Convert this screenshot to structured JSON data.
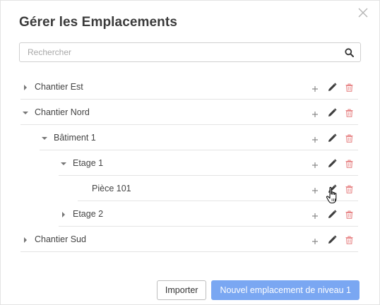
{
  "dialog": {
    "title": "Gérer les Emplacements"
  },
  "search": {
    "placeholder": "Rechercher",
    "value": ""
  },
  "tree": {
    "rows": [
      {
        "label": "Chantier Est",
        "toggle": "collapsed"
      },
      {
        "label": "Chantier Nord",
        "toggle": "expanded"
      },
      {
        "label": "Bâtiment 1",
        "toggle": "expanded"
      },
      {
        "label": "Etage 1",
        "toggle": "expanded"
      },
      {
        "label": "Pièce 101",
        "toggle": "none"
      },
      {
        "label": "Etage 2",
        "toggle": "collapsed"
      },
      {
        "label": "Chantier Sud",
        "toggle": "collapsed"
      }
    ],
    "action_icons": [
      "plus-icon",
      "pencil-icon",
      "trash-icon"
    ]
  },
  "footer": {
    "import_label": "Importer",
    "new_label": "Nouvel emplacement de niveau 1"
  },
  "colors": {
    "primary_button": "#7aa7f2",
    "delete_icon": "#e8898a",
    "edit_icon": "#3d3d3d",
    "add_icon": "#8a8a8a"
  }
}
